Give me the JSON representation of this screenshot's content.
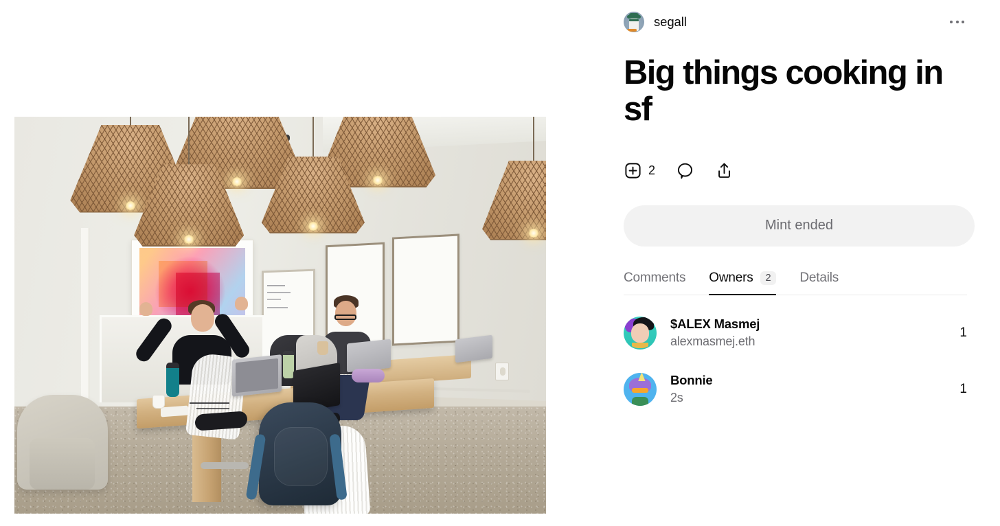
{
  "creator": {
    "handle": "segall",
    "avatar_icon": "segall-pfp-icon",
    "more_menu_icon": "ellipsis-horizontal-icon"
  },
  "post": {
    "title": "Big things cooking in sf",
    "media_alt": "office-photo"
  },
  "actions": {
    "collect": {
      "icon": "plus-square-icon",
      "count": "2"
    },
    "comment": {
      "icon": "comment-bubble-icon"
    },
    "share": {
      "icon": "share-arrow-icon"
    }
  },
  "mint": {
    "button_label": "Mint ended",
    "background": "#f2f2f2",
    "text_color": "#6b6b70"
  },
  "tabs": [
    {
      "label": "Comments",
      "badge": null,
      "active": false
    },
    {
      "label": "Owners",
      "badge": "2",
      "active": true
    },
    {
      "label": "Details",
      "badge": null,
      "active": false
    }
  ],
  "owners": [
    {
      "name": "$ALEX Masmej",
      "subtitle": "alexmasmej.eth",
      "count": "1",
      "avatar_icon": "alex-masmej-pfp-icon"
    },
    {
      "name": "Bonnie",
      "subtitle": "2s",
      "count": "1",
      "avatar_icon": "bonnie-pfp-icon"
    }
  ],
  "theme": {
    "background": "#ffffff",
    "text_primary": "#0a0a0a",
    "text_secondary": "#6d6d72",
    "divider": "#ebebeb"
  }
}
